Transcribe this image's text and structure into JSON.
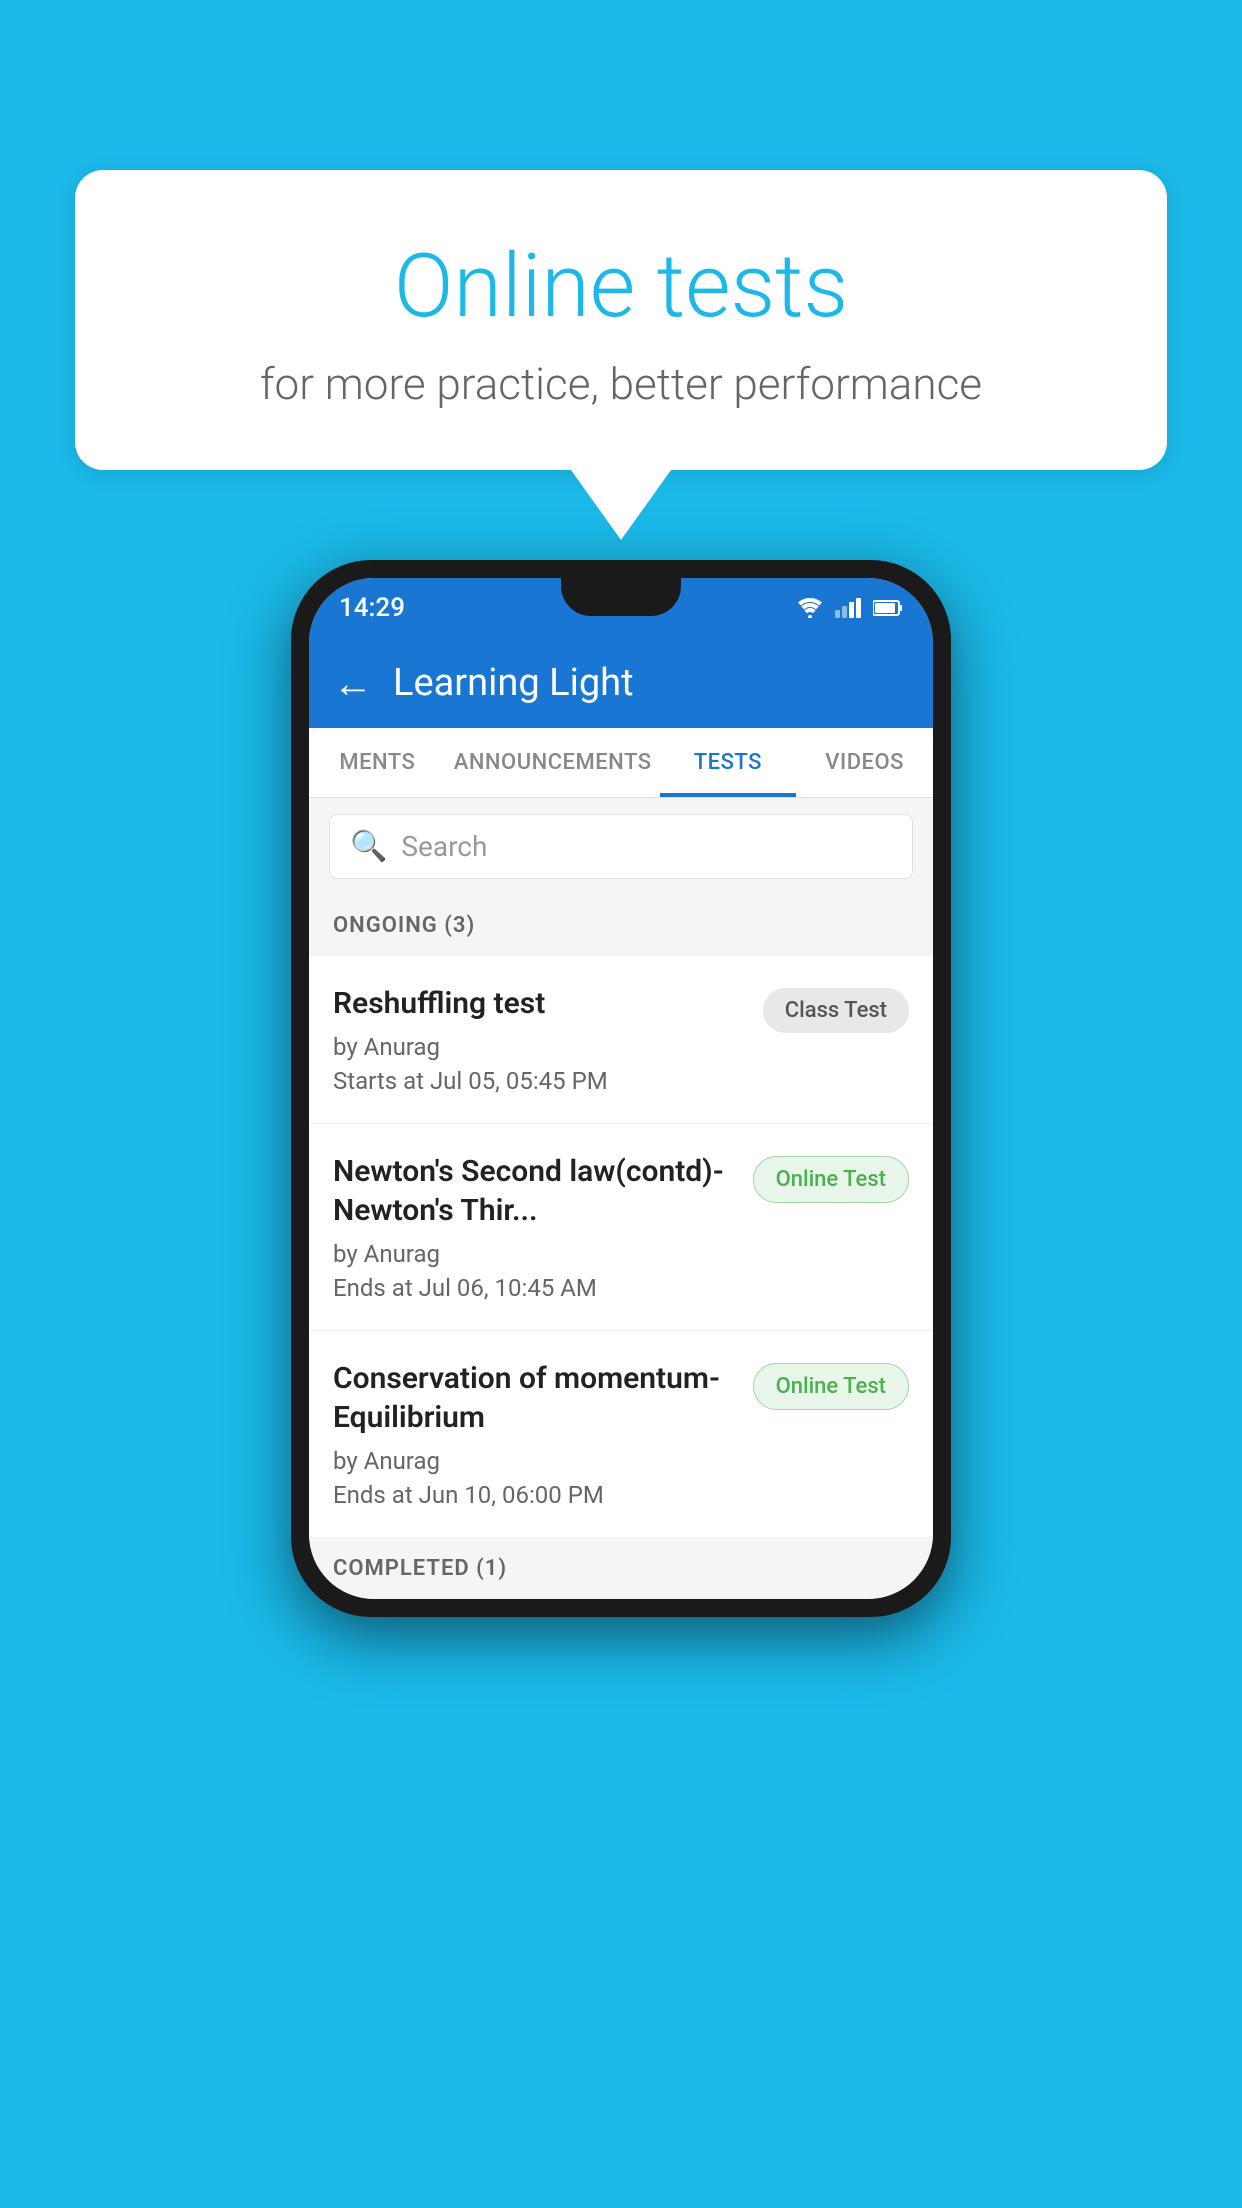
{
  "background": {
    "color": "#1bb8e8"
  },
  "speech_bubble": {
    "title": "Online tests",
    "subtitle": "for more practice, better performance"
  },
  "phone": {
    "status_bar": {
      "time": "14:29"
    },
    "app_bar": {
      "back_label": "←",
      "title": "Learning Light"
    },
    "tabs": [
      {
        "label": "MENTS",
        "active": false
      },
      {
        "label": "ANNOUNCEMENTS",
        "active": false
      },
      {
        "label": "TESTS",
        "active": true
      },
      {
        "label": "VIDEOS",
        "active": false
      }
    ],
    "search": {
      "placeholder": "Search"
    },
    "ongoing_section": {
      "label": "ONGOING (3)"
    },
    "tests": [
      {
        "name": "Reshuffling test",
        "author": "by Anurag",
        "time_label": "Starts at",
        "time": "Jul 05, 05:45 PM",
        "badge": "Class Test",
        "badge_type": "class"
      },
      {
        "name": "Newton's Second law(contd)-Newton's Thir...",
        "author": "by Anurag",
        "time_label": "Ends at",
        "time": "Jul 06, 10:45 AM",
        "badge": "Online Test",
        "badge_type": "online"
      },
      {
        "name": "Conservation of momentum-Equilibrium",
        "author": "by Anurag",
        "time_label": "Ends at",
        "time": "Jun 10, 06:00 PM",
        "badge": "Online Test",
        "badge_type": "online"
      }
    ],
    "completed_section": {
      "label": "COMPLETED (1)"
    }
  }
}
